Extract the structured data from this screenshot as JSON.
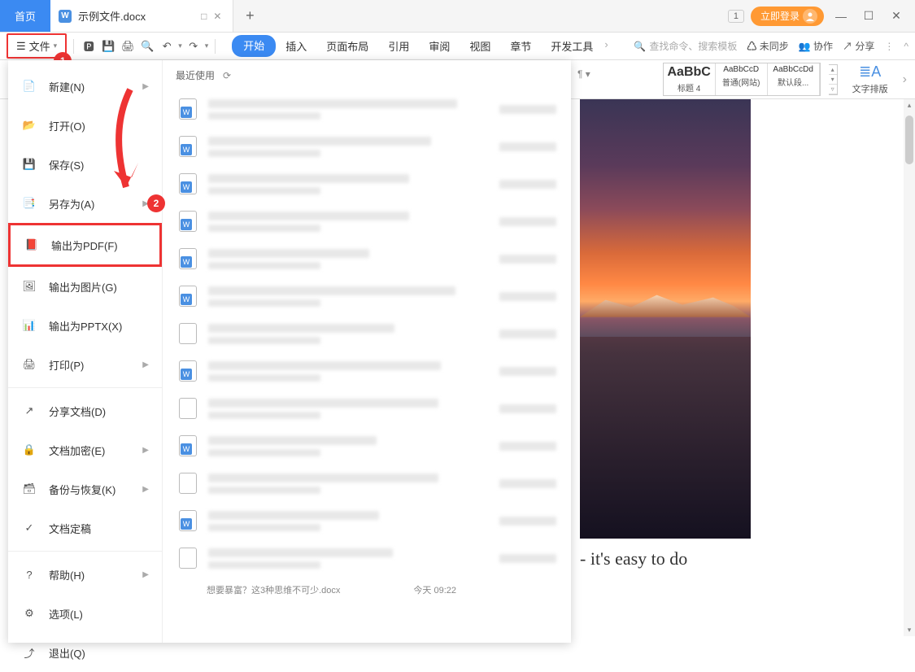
{
  "titlebar": {
    "home": "首页",
    "doc_name": "示例文件.docx",
    "badge": "1",
    "login": "立即登录"
  },
  "toolbar": {
    "file": "文件",
    "tabs": [
      "开始",
      "插入",
      "页面布局",
      "引用",
      "审阅",
      "视图",
      "章节",
      "开发工具"
    ],
    "search": "查找命令、搜索模板",
    "unsync": "未同步",
    "collab": "协作",
    "share": "分享"
  },
  "ribbon": {
    "styles": [
      {
        "preview": "AaBbC",
        "label": "标题 4"
      },
      {
        "preview": "AaBbCcD",
        "label": "普通(网站)"
      },
      {
        "preview": "AaBbCcDd",
        "label": "默认段..."
      }
    ],
    "text_layout": "文字排版"
  },
  "file_menu": {
    "items": [
      {
        "label": "新建(N)",
        "icon": "new",
        "chev": true
      },
      {
        "label": "打开(O)",
        "icon": "open"
      },
      {
        "label": "保存(S)",
        "icon": "save"
      },
      {
        "label": "另存为(A)",
        "icon": "saveas",
        "chev": true,
        "badge": "2"
      },
      {
        "label": "输出为PDF(F)",
        "icon": "pdf",
        "hl": true
      },
      {
        "label": "输出为图片(G)",
        "icon": "img"
      },
      {
        "label": "输出为PPTX(X)",
        "icon": "pptx"
      },
      {
        "label": "打印(P)",
        "icon": "print",
        "chev": true
      },
      {
        "label": "分享文档(D)",
        "icon": "share",
        "div": true
      },
      {
        "label": "文档加密(E)",
        "icon": "lock",
        "chev": true
      },
      {
        "label": "备份与恢复(K)",
        "icon": "backup",
        "chev": true
      },
      {
        "label": "文档定稿",
        "icon": "final"
      },
      {
        "label": "帮助(H)",
        "icon": "help",
        "chev": true,
        "div": true
      },
      {
        "label": "选项(L)",
        "icon": "options"
      },
      {
        "label": "退出(Q)",
        "icon": "exit"
      }
    ],
    "recent_title": "最近使用",
    "footer_file": "想要暴富？这3种思维不可少.docx",
    "footer_time": "今天  09:22"
  },
  "doc": {
    "text_fragment": "- it's easy to do"
  },
  "badges": {
    "b1": "1",
    "b2": "2"
  }
}
